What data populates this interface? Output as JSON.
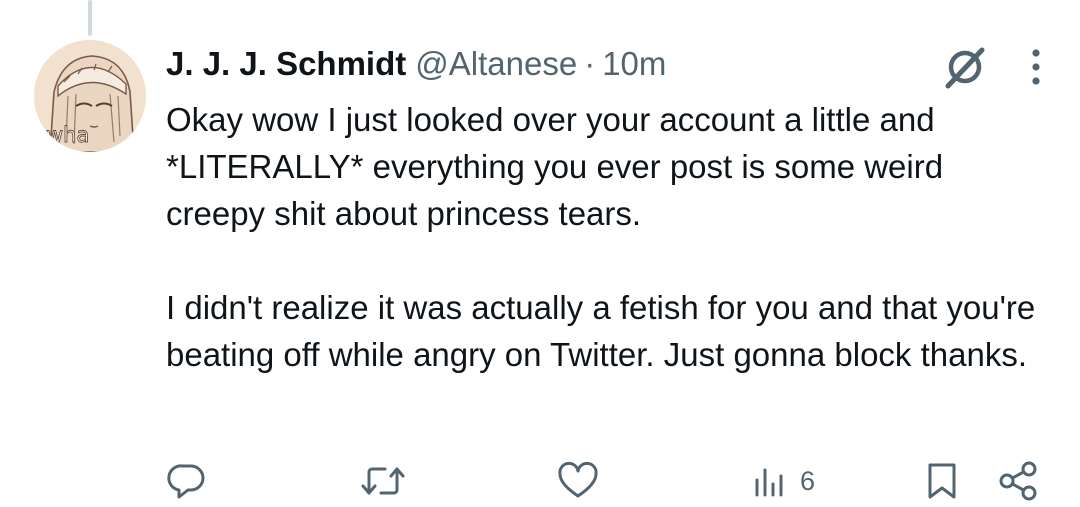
{
  "author": {
    "display_name": "J. J. J. Schmidt",
    "handle": "@Altanese",
    "separator": "·",
    "time": "10m",
    "avatar_text": "wha"
  },
  "tweet": {
    "paragraphs": [
      "Okay wow I just looked over your account a little and *LITERALLY* everything you ever post is some weird creepy shit about princess tears.",
      "I didn't realize it was actually a fetish for you and that you're beating off while angry on Twitter. Just gonna block thanks."
    ]
  },
  "actions": {
    "views_count": "6"
  },
  "icons": {
    "reply": "reply-icon",
    "repost": "repost-icon",
    "like": "heart-icon",
    "views": "views-icon",
    "bookmark": "bookmark-icon",
    "share": "share-icon",
    "grok": "grok-icon",
    "more": "more-icon"
  },
  "colors": {
    "text_primary": "#0f1419",
    "text_secondary": "#536471",
    "thread_line": "#cfd9de"
  }
}
